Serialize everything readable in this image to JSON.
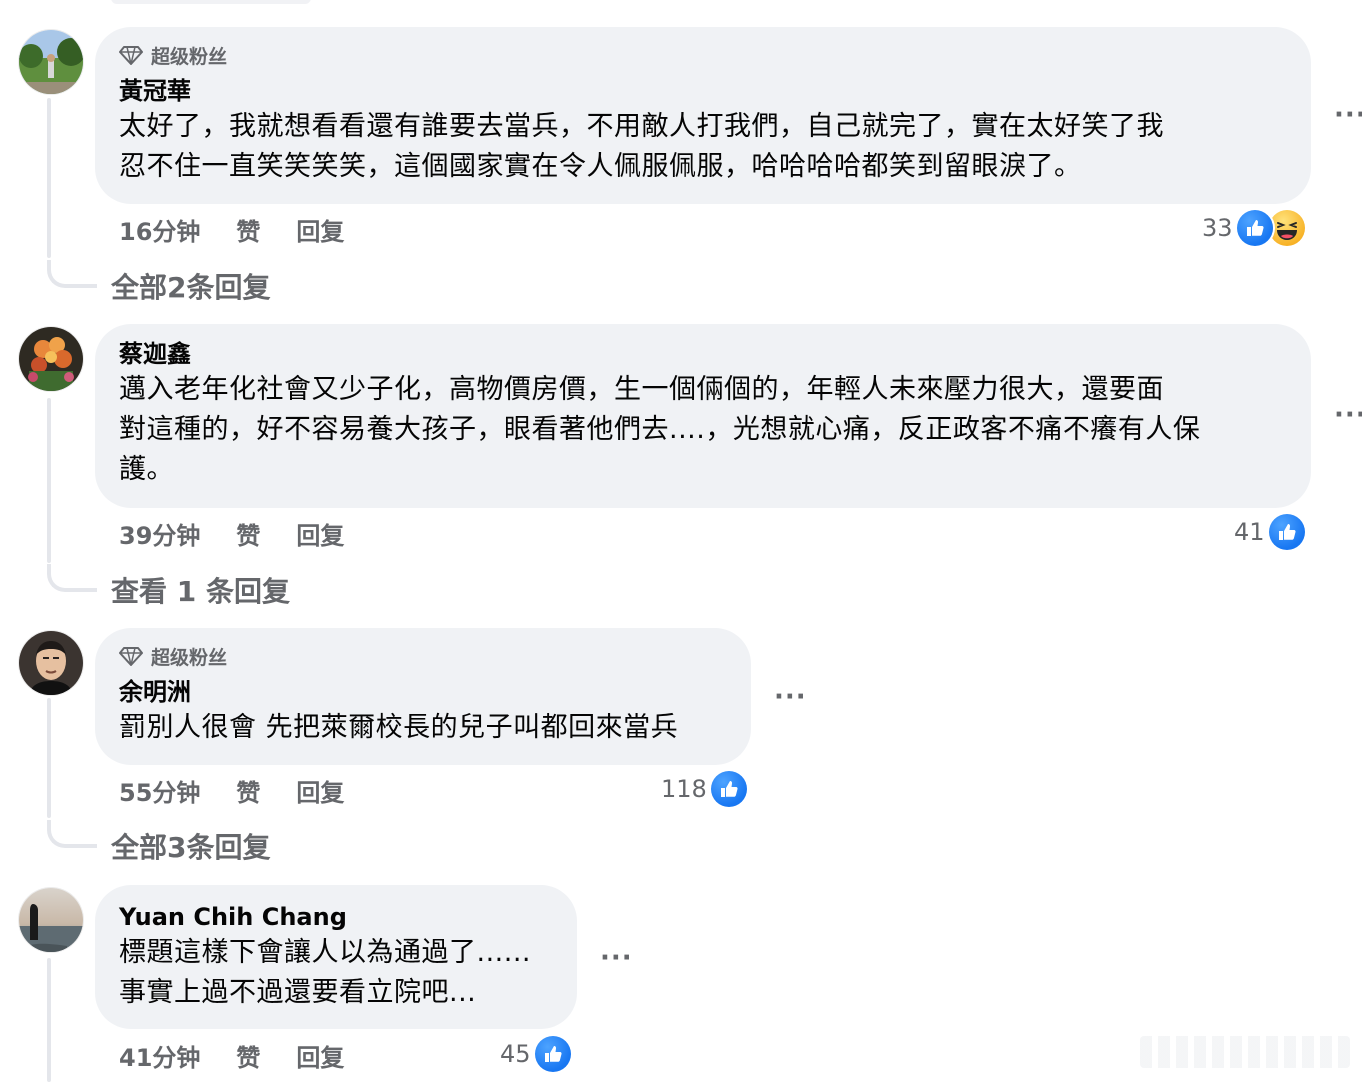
{
  "comments": [
    {
      "badge": "超级粉丝",
      "author": "黃冠華",
      "text": "太好了，我就想看看還有誰要去當兵，不用敵人打我們，自己就完了，實在太好笑了我\n忍不住一直笑笑笑笑，這個國家實在令人佩服佩服，哈哈哈哈都笑到留眼淚了。",
      "time": "16分钟",
      "like_label": "赞",
      "reply_label": "回复",
      "reaction_count": "33",
      "reactions": [
        "like-icon",
        "haha-icon"
      ],
      "view_replies": "全部2条回复"
    },
    {
      "author": "蔡迦鑫",
      "text": "邁入老年化社會又少子化，高物價房價，生一個倆個的，年輕人未來壓力很大，還要面\n對這種的，好不容易養大孩子，眼看著他們去....，光想就心痛，反正政客不痛不癢有人保\n護。",
      "time": "39分钟",
      "like_label": "赞",
      "reply_label": "回复",
      "reaction_count": "41",
      "reactions": [
        "like-icon"
      ],
      "view_replies": "查看 1 条回复"
    },
    {
      "badge": "超级粉丝",
      "author": "余明洲",
      "text": "罰別人很會 先把萊爾校長的兒子叫都回來當兵",
      "time": "55分钟",
      "like_label": "赞",
      "reply_label": "回复",
      "reaction_count": "118",
      "reactions": [
        "like-icon"
      ],
      "view_replies": "全部3条回复"
    },
    {
      "author": "Yuan Chih Chang",
      "text": "標題這樣下會讓人以為通過了......\n事實上過不過還要看立院吧...",
      "time": "41分钟",
      "like_label": "赞",
      "reply_label": "回复",
      "reaction_count": "45",
      "reactions": [
        "like-icon"
      ]
    }
  ],
  "more_glyph": "···",
  "colors": {
    "bubble": "#f0f2f5",
    "meta_text": "#65676b",
    "like_blue": "#1877f2"
  }
}
